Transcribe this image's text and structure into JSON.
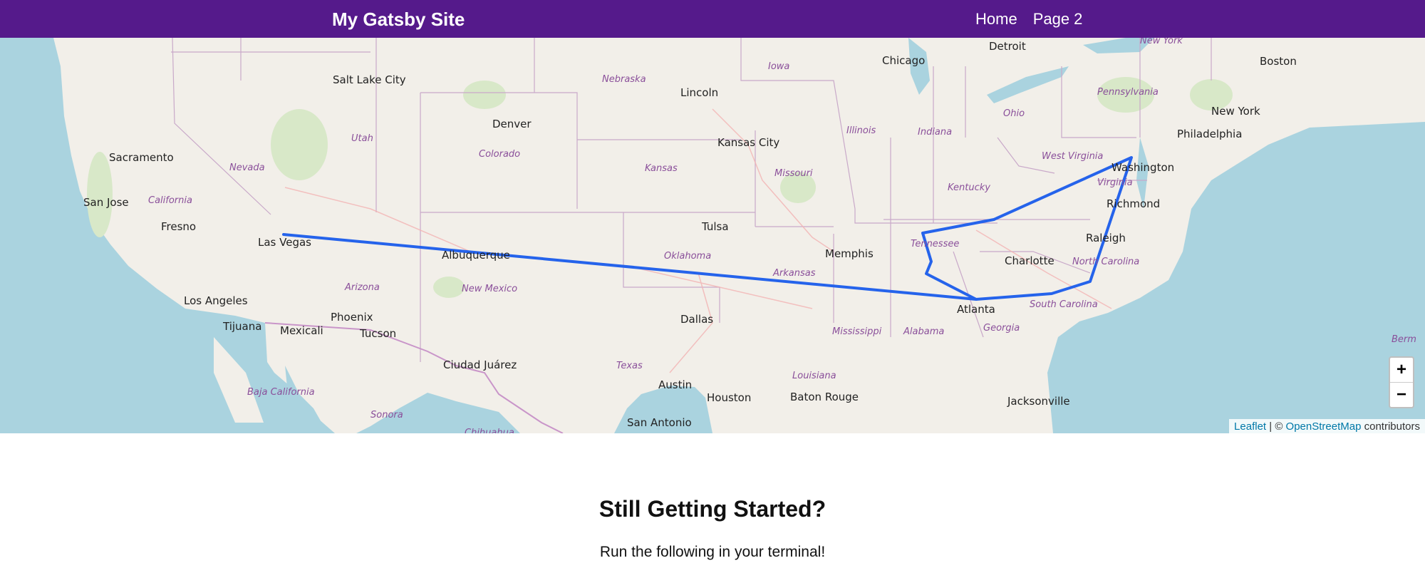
{
  "header": {
    "title": "My Gatsby Site",
    "nav": [
      "Home",
      "Page 2"
    ]
  },
  "map": {
    "cities": [
      "Salt Lake City",
      "Denver",
      "Lincoln",
      "Chicago",
      "Detroit",
      "Boston",
      "New York",
      "Philadelphia",
      "Washington",
      "Richmond",
      "Raleigh",
      "Charlotte",
      "Atlanta",
      "Jacksonville",
      "Memphis",
      "Tulsa",
      "Kansas City",
      "Dallas",
      "Austin",
      "Houston",
      "San Antonio",
      "Baton Rouge",
      "Albuquerque",
      "Phoenix",
      "Tucson",
      "Las Vegas",
      "Los Angeles",
      "Tijuana",
      "Mexicali",
      "Ciudad Juárez",
      "Sacramento",
      "San Jose",
      "Fresno"
    ],
    "regions": [
      "Nebraska",
      "Iowa",
      "Utah",
      "Colorado",
      "Nevada",
      "California",
      "Kansas",
      "Missouri",
      "Illinois",
      "Indiana",
      "Ohio",
      "Pennsylvania",
      "New York",
      "West Virginia",
      "Virginia",
      "Kentucky",
      "Tennessee",
      "North Carolina",
      "South Carolina",
      "Georgia",
      "Alabama",
      "Mississippi",
      "Louisiana",
      "Arkansas",
      "Oklahoma",
      "Texas",
      "New Mexico",
      "Arizona",
      "Baja California",
      "Sonora",
      "Chihuahua",
      "Berm"
    ],
    "zoom_in": "+",
    "zoom_out": "−",
    "attribution": {
      "leaflet": "Leaflet",
      "separator": " | © ",
      "osm": "OpenStreetMap",
      "suffix": " contributors"
    },
    "route_color": "#2563eb"
  },
  "content": {
    "heading": "Still Getting Started?",
    "text": "Run the following in your terminal!"
  }
}
